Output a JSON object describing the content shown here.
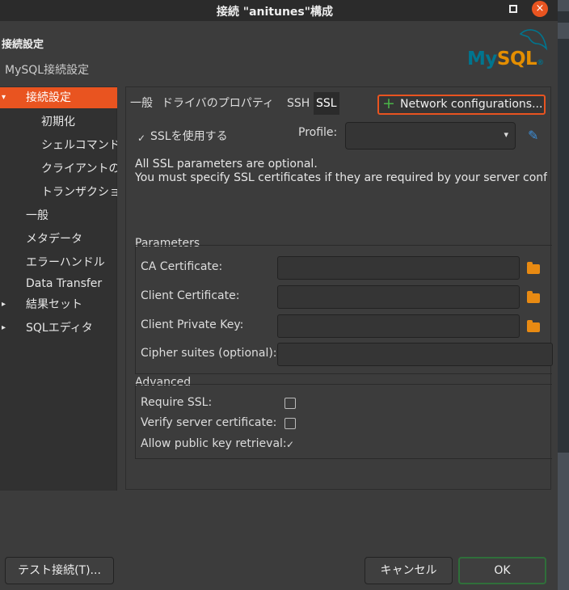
{
  "window": {
    "title": "接続 \"anitunes\"構成",
    "close_glyph": "×"
  },
  "header": {
    "title": "接続設定",
    "subtitle": "MySQL接続設定",
    "logo_text_main": "My",
    "logo_text_accent": "SQL",
    "logo_mark": "®"
  },
  "sidebar": {
    "items": [
      {
        "label": "接続設定",
        "arrow": "▾",
        "active": true
      },
      {
        "label": "初期化"
      },
      {
        "label": "シェルコマンド"
      },
      {
        "label": "クライアントの"
      },
      {
        "label": "トランザクショ"
      },
      {
        "label": "一般"
      },
      {
        "label": "メタデータ"
      },
      {
        "label": "エラーハンドル"
      },
      {
        "label": "Data Transfer"
      },
      {
        "label": "結果セット",
        "arrow": "▸"
      },
      {
        "label": "SQLエディタ",
        "arrow": "▸"
      }
    ]
  },
  "tabs": [
    {
      "label": "一般"
    },
    {
      "label": "ドライバのプロパティ"
    },
    {
      "label": "SSH"
    },
    {
      "label": "SSL",
      "active": true
    }
  ],
  "network_button": {
    "label": "Network configurations...",
    "icon": "plus-icon",
    "glyph": "+"
  },
  "ssl": {
    "use_ssl_label": "SSLを使用する",
    "use_ssl_checked": true,
    "check_glyph": "✓",
    "profile_label": "Profile:",
    "profile_value": "",
    "caret_glyph": "▾",
    "edit_glyph": "✎",
    "note_line1": "All SSL parameters are optional.",
    "note_line2": "You must specify SSL certificates if they are required by your server configura"
  },
  "parameters": {
    "title": "Parameters",
    "fields": [
      {
        "label": "CA Certificate:",
        "value": ""
      },
      {
        "label": "Client Certificate:",
        "value": ""
      },
      {
        "label": "Client Private Key:",
        "value": ""
      },
      {
        "label": "Cipher suites (optional):",
        "value": ""
      }
    ]
  },
  "advanced": {
    "title": "Advanced",
    "options": [
      {
        "label": "Require SSL:",
        "checked": false
      },
      {
        "label": "Verify server certificate:",
        "checked": false
      },
      {
        "label": "Allow public key retrieval:",
        "checked": true
      }
    ]
  },
  "footer": {
    "test_button": "テスト接続(T)...",
    "cancel_button": "キャンセル",
    "ok_button": "OK"
  },
  "colors": {
    "accent": "#e95420",
    "logo_blue": "#00758f",
    "logo_orange": "#e48e00",
    "folder": "#e88a12",
    "plus": "#4ab348",
    "pencil": "#3d8fd9"
  }
}
